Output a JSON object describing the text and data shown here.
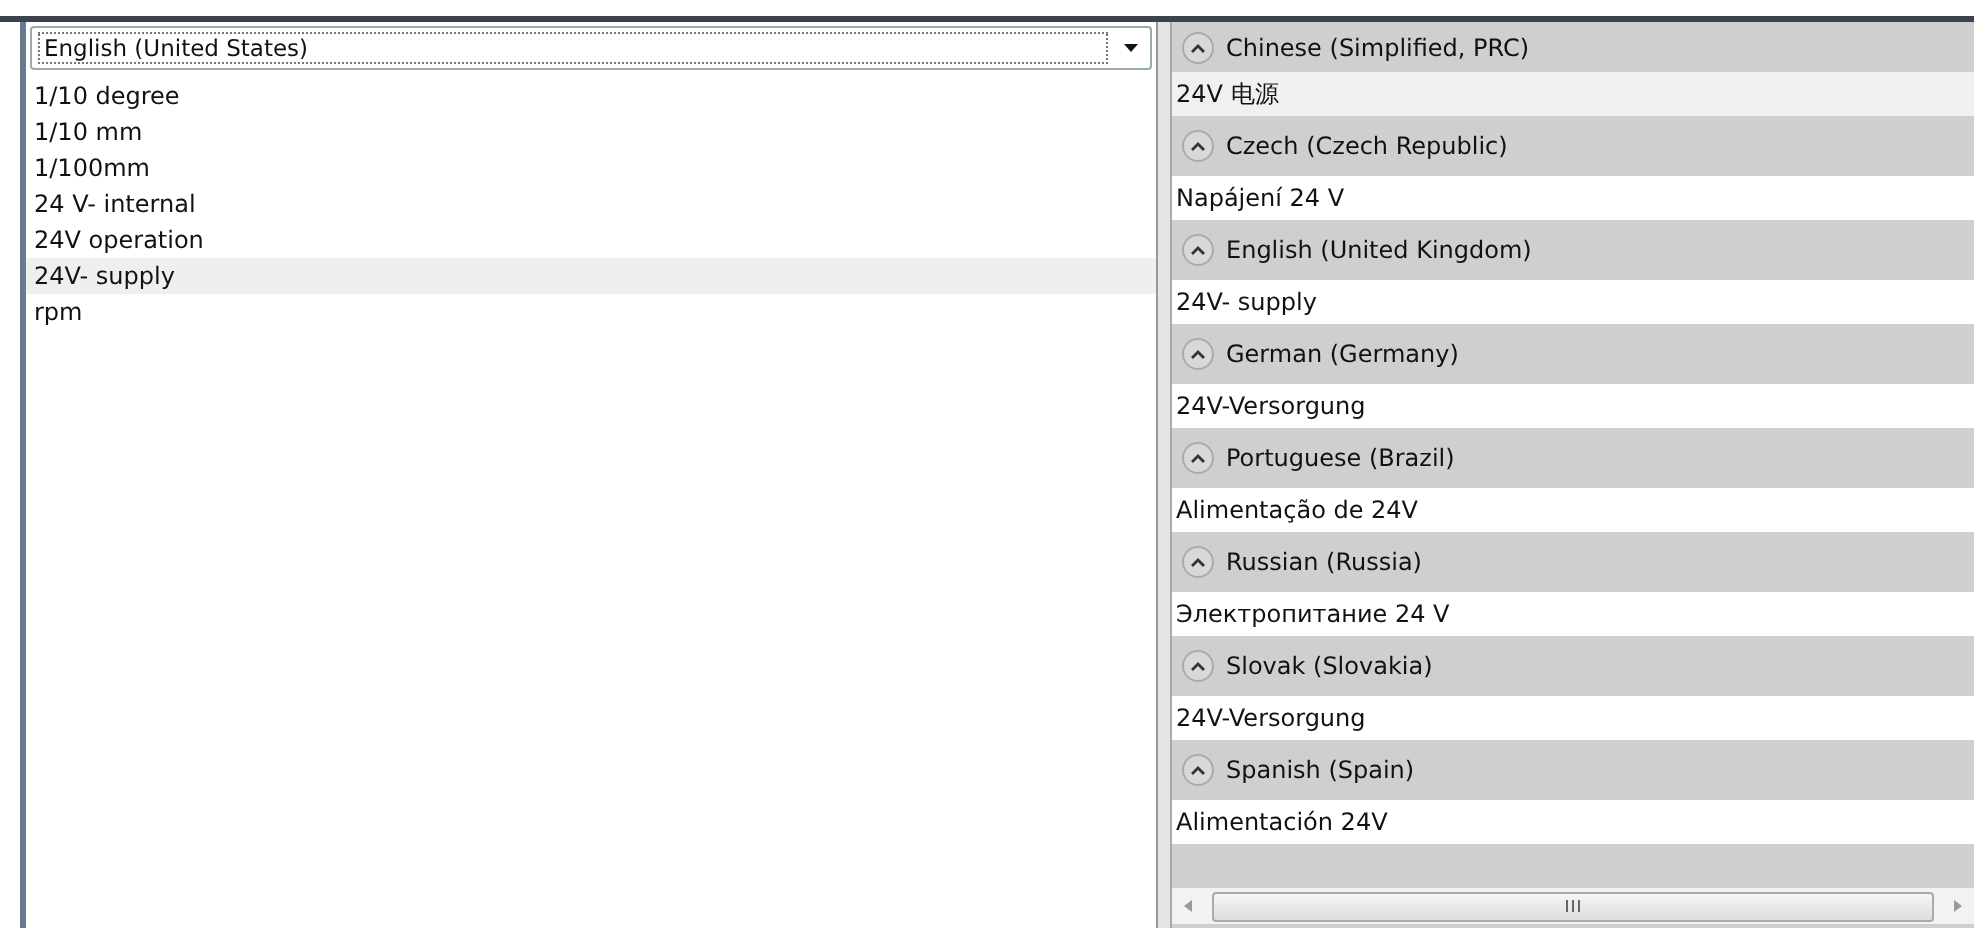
{
  "language_dropdown": {
    "value": "English (United States)"
  },
  "terms": [
    {
      "label": "1/10 degree",
      "selected": false
    },
    {
      "label": "1/10 mm",
      "selected": false
    },
    {
      "label": "1/100mm",
      "selected": false
    },
    {
      "label": "24 V- internal",
      "selected": false
    },
    {
      "label": "24V operation",
      "selected": false
    },
    {
      "label": "24V- supply",
      "selected": true
    },
    {
      "label": "rpm",
      "selected": false
    }
  ],
  "translations": [
    {
      "language": "Chinese (Simplified, PRC)",
      "expanded": true,
      "value": "24V 电源",
      "selected": true
    },
    {
      "language": "Czech (Czech Republic)",
      "expanded": true,
      "value": "Napájení 24 V",
      "selected": false
    },
    {
      "language": "English (United Kingdom)",
      "expanded": true,
      "value": "24V- supply",
      "selected": false
    },
    {
      "language": "German (Germany)",
      "expanded": true,
      "value": "24V-Versorgung",
      "selected": false
    },
    {
      "language": "Portuguese (Brazil)",
      "expanded": true,
      "value": "Alimentação de 24V",
      "selected": false
    },
    {
      "language": "Russian (Russia)",
      "expanded": true,
      "value": "Электропитание 24 V",
      "selected": false
    },
    {
      "language": "Slovak (Slovakia)",
      "expanded": true,
      "value": "24V-Versorgung",
      "selected": false
    },
    {
      "language": "Spanish (Spain)",
      "expanded": true,
      "value": "Alimentación 24V",
      "selected": false
    }
  ]
}
